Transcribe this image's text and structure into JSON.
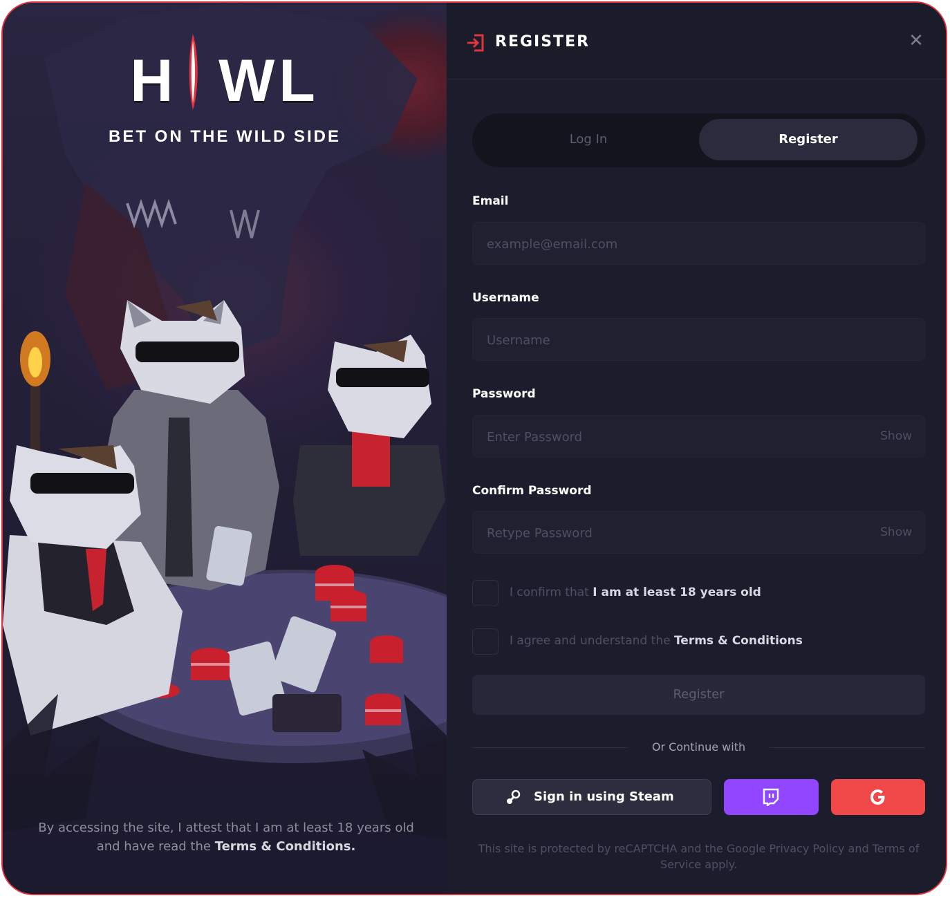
{
  "brand": {
    "logo_text": "H  WL",
    "tagline": "BET ON THE WILD SIDE"
  },
  "left_panel": {
    "disclaimer_prefix": "By accessing the site, I attest that I am at least 18 years old and have read the ",
    "disclaimer_link": "Terms & Conditions."
  },
  "header": {
    "title": "REGISTER",
    "icon": "login-arrow-icon",
    "close_icon": "close-icon",
    "close_glyph": "✕"
  },
  "tabs": {
    "login": "Log In",
    "register": "Register",
    "active": "register"
  },
  "form": {
    "email": {
      "label": "Email",
      "placeholder": "example@email.com",
      "value": ""
    },
    "username": {
      "label": "Username",
      "placeholder": "Username",
      "value": ""
    },
    "password": {
      "label": "Password",
      "placeholder": "Enter Password",
      "value": "",
      "toggle": "Show"
    },
    "confirm_password": {
      "label": "Confirm Password",
      "placeholder": "Retype Password",
      "value": "",
      "toggle": "Show"
    },
    "age_check": {
      "prefix": "I confirm that ",
      "bold": "I am at least 18 years old",
      "checked": false
    },
    "terms_check": {
      "prefix": "I agree and understand the ",
      "bold": "Terms & Conditions",
      "checked": false
    },
    "submit_label": "Register"
  },
  "social": {
    "divider_text": "Or Continue with",
    "steam_label": "Sign in using Steam",
    "steam_icon": "steam-icon",
    "twitch_icon": "twitch-icon",
    "google_icon": "google-icon",
    "colors": {
      "twitch": "#9146ff",
      "google": "#f04848",
      "accent": "#e0343f"
    }
  },
  "footer": {
    "recaptcha": "This site is protected by reCAPTCHA and the Google Privacy Policy and Terms of Service apply."
  }
}
